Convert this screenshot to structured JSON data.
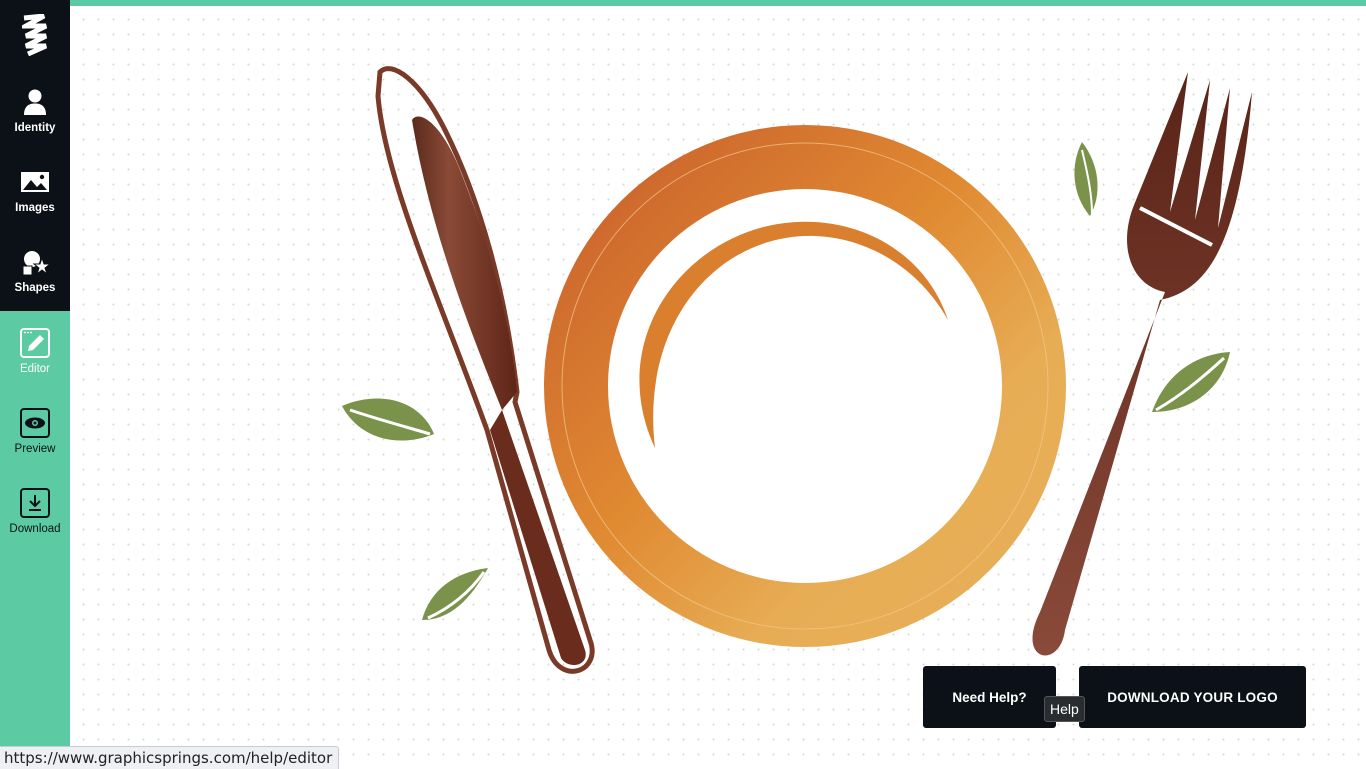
{
  "sidebar": {
    "logo_icon": "graphicsprings-logo",
    "items": [
      {
        "label": "Identity",
        "icon": "person-icon"
      },
      {
        "label": "Images",
        "icon": "image-icon"
      },
      {
        "label": "Shapes",
        "icon": "shapes-icon"
      },
      {
        "label": "Editor",
        "icon": "edit-icon"
      },
      {
        "label": "Preview",
        "icon": "eye-icon"
      },
      {
        "label": "Download",
        "icon": "download-icon"
      }
    ]
  },
  "buttons": {
    "help_label": "Need Help?",
    "download_label": "DOWNLOAD YOUR LOGO"
  },
  "tooltip": {
    "text": "Help"
  },
  "status": {
    "url": "https://www.graphicsprings.com/help/editor"
  },
  "colors": {
    "accent": "#5ccba3",
    "sidebar_dark": "#0c1117",
    "button_dark": "#0c1117",
    "plate_orange": "#d98230",
    "cutlery_brown": "#6b2f20",
    "leaf_green": "#7a924a"
  }
}
